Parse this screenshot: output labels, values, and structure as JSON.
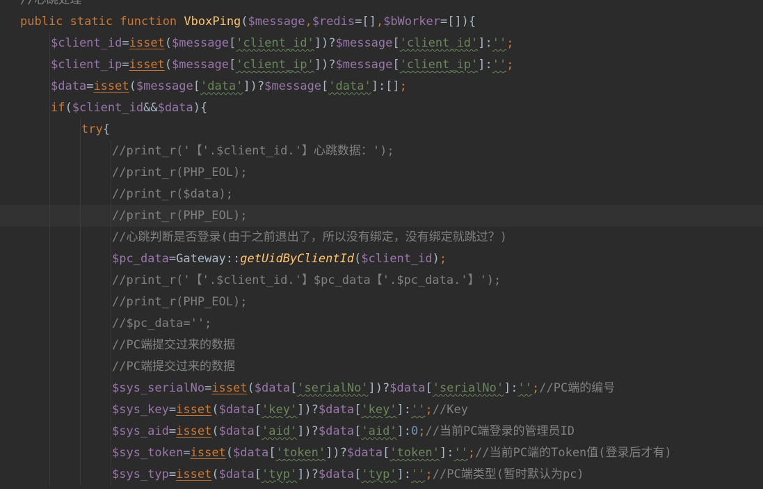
{
  "editor": {
    "lines": [
      {
        "indent": 0,
        "segments": [
          {
            "c": "cmt",
            "t": "//心跳处理"
          }
        ]
      },
      {
        "indent": 0,
        "segments": [
          {
            "c": "kw",
            "t": "public static function "
          },
          {
            "c": "fn",
            "t": "VboxPing"
          },
          {
            "c": "",
            "t": "("
          },
          {
            "c": "var",
            "t": "$message"
          },
          {
            "c": "kw",
            "t": ","
          },
          {
            "c": "var",
            "t": "$redis"
          },
          {
            "c": "",
            "t": "=[]"
          },
          {
            "c": "kw",
            "t": ","
          },
          {
            "c": "var",
            "t": "$bWorker"
          },
          {
            "c": "",
            "t": "=[]){"
          }
        ]
      },
      {
        "indent": 1,
        "segments": [
          {
            "c": "var",
            "t": "$client_id"
          },
          {
            "c": "",
            "t": "="
          },
          {
            "c": "kw uline",
            "t": "isset"
          },
          {
            "c": "",
            "t": "("
          },
          {
            "c": "var",
            "t": "$message"
          },
          {
            "c": "",
            "t": "["
          },
          {
            "c": "str wavy",
            "t": "'client_id'"
          },
          {
            "c": "",
            "t": "])?"
          },
          {
            "c": "var",
            "t": "$message"
          },
          {
            "c": "",
            "t": "["
          },
          {
            "c": "str wavy",
            "t": "'client_id'"
          },
          {
            "c": "",
            "t": "]:"
          },
          {
            "c": "str wavy",
            "t": "''"
          },
          {
            "c": "kw",
            "t": ";"
          }
        ]
      },
      {
        "indent": 1,
        "segments": [
          {
            "c": "var",
            "t": "$client_ip"
          },
          {
            "c": "",
            "t": "="
          },
          {
            "c": "kw uline",
            "t": "isset"
          },
          {
            "c": "",
            "t": "("
          },
          {
            "c": "var",
            "t": "$message"
          },
          {
            "c": "",
            "t": "["
          },
          {
            "c": "str wavy",
            "t": "'client_ip'"
          },
          {
            "c": "",
            "t": "])?"
          },
          {
            "c": "var",
            "t": "$message"
          },
          {
            "c": "",
            "t": "["
          },
          {
            "c": "str wavy",
            "t": "'client_ip'"
          },
          {
            "c": "",
            "t": "]:"
          },
          {
            "c": "str wavy",
            "t": "''"
          },
          {
            "c": "kw",
            "t": ";"
          }
        ]
      },
      {
        "indent": 1,
        "segments": [
          {
            "c": "var",
            "t": "$data"
          },
          {
            "c": "",
            "t": "="
          },
          {
            "c": "kw uline",
            "t": "isset"
          },
          {
            "c": "",
            "t": "("
          },
          {
            "c": "var",
            "t": "$message"
          },
          {
            "c": "",
            "t": "["
          },
          {
            "c": "str wavy",
            "t": "'data'"
          },
          {
            "c": "",
            "t": "])?"
          },
          {
            "c": "var",
            "t": "$message"
          },
          {
            "c": "",
            "t": "["
          },
          {
            "c": "str wavy",
            "t": "'data'"
          },
          {
            "c": "",
            "t": "]:[]"
          },
          {
            "c": "kw",
            "t": ";"
          }
        ]
      },
      {
        "indent": 1,
        "segments": [
          {
            "c": "kw",
            "t": "if"
          },
          {
            "c": "",
            "t": "("
          },
          {
            "c": "var",
            "t": "$client_id"
          },
          {
            "c": "",
            "t": "&&"
          },
          {
            "c": "var",
            "t": "$data"
          },
          {
            "c": "",
            "t": "){"
          }
        ]
      },
      {
        "indent": 2,
        "segments": [
          {
            "c": "kw",
            "t": "try"
          },
          {
            "c": "",
            "t": "{"
          }
        ]
      },
      {
        "indent": 3,
        "segments": [
          {
            "c": "cmt",
            "t": "//print_r('【'.$client_id.'】心跳数据：');"
          }
        ]
      },
      {
        "indent": 3,
        "segments": [
          {
            "c": "cmt",
            "t": "//print_r(PHP_EOL);"
          }
        ]
      },
      {
        "indent": 3,
        "segments": [
          {
            "c": "cmt",
            "t": "//print_r($data);"
          }
        ]
      },
      {
        "indent": 3,
        "current": true,
        "segments": [
          {
            "c": "cmt",
            "t": "//print_r(PHP_EOL);"
          }
        ]
      },
      {
        "indent": 3,
        "segments": [
          {
            "c": "cmt",
            "t": "//心跳判断是否登录(由于之前退出了，所以没有绑定，没有绑定就跳过？)"
          }
        ]
      },
      {
        "indent": 3,
        "segments": [
          {
            "c": "var",
            "t": "$pc_data"
          },
          {
            "c": "",
            "t": "="
          },
          {
            "c": "cls",
            "t": "Gateway"
          },
          {
            "c": "",
            "t": "::"
          },
          {
            "c": "call",
            "t": "getUidByClientId"
          },
          {
            "c": "",
            "t": "("
          },
          {
            "c": "var",
            "t": "$client_id"
          },
          {
            "c": "",
            "t": ")"
          },
          {
            "c": "kw",
            "t": ";"
          }
        ]
      },
      {
        "indent": 3,
        "segments": [
          {
            "c": "cmt",
            "t": "//print_r('【'.$client_id.'】$pc_data【'.$pc_data.'】');"
          }
        ]
      },
      {
        "indent": 3,
        "segments": [
          {
            "c": "cmt",
            "t": "//print_r(PHP_EOL);"
          }
        ]
      },
      {
        "indent": 3,
        "segments": [
          {
            "c": "cmt",
            "t": "//$pc_data='';"
          }
        ]
      },
      {
        "indent": 3,
        "segments": [
          {
            "c": "cmt",
            "t": "//PC端提交过来的数据"
          }
        ]
      },
      {
        "indent": 3,
        "segments": [
          {
            "c": "cmt",
            "t": "//PC端提交过来的数据"
          }
        ]
      },
      {
        "indent": 3,
        "segments": [
          {
            "c": "var",
            "t": "$sys_serialNo"
          },
          {
            "c": "",
            "t": "="
          },
          {
            "c": "kw uline",
            "t": "isset"
          },
          {
            "c": "",
            "t": "("
          },
          {
            "c": "var",
            "t": "$data"
          },
          {
            "c": "",
            "t": "["
          },
          {
            "c": "str wavy",
            "t": "'serialNo'"
          },
          {
            "c": "",
            "t": "])?"
          },
          {
            "c": "var",
            "t": "$data"
          },
          {
            "c": "",
            "t": "["
          },
          {
            "c": "str wavy",
            "t": "'serialNo'"
          },
          {
            "c": "",
            "t": "]:"
          },
          {
            "c": "str wavy",
            "t": "''"
          },
          {
            "c": "kw",
            "t": ";"
          },
          {
            "c": "cmt",
            "t": "//PC端的编号"
          }
        ]
      },
      {
        "indent": 3,
        "segments": [
          {
            "c": "var",
            "t": "$sys_key"
          },
          {
            "c": "",
            "t": "="
          },
          {
            "c": "kw uline",
            "t": "isset"
          },
          {
            "c": "",
            "t": "("
          },
          {
            "c": "var",
            "t": "$data"
          },
          {
            "c": "",
            "t": "["
          },
          {
            "c": "str wavy",
            "t": "'key'"
          },
          {
            "c": "",
            "t": "])?"
          },
          {
            "c": "var",
            "t": "$data"
          },
          {
            "c": "",
            "t": "["
          },
          {
            "c": "str wavy",
            "t": "'key'"
          },
          {
            "c": "",
            "t": "]:"
          },
          {
            "c": "str wavy",
            "t": "''"
          },
          {
            "c": "kw",
            "t": ";"
          },
          {
            "c": "cmt",
            "t": "//Key"
          }
        ]
      },
      {
        "indent": 3,
        "segments": [
          {
            "c": "var",
            "t": "$sys_aid"
          },
          {
            "c": "",
            "t": "="
          },
          {
            "c": "kw uline",
            "t": "isset"
          },
          {
            "c": "",
            "t": "("
          },
          {
            "c": "var",
            "t": "$data"
          },
          {
            "c": "",
            "t": "["
          },
          {
            "c": "str wavy",
            "t": "'aid'"
          },
          {
            "c": "",
            "t": "])?"
          },
          {
            "c": "var",
            "t": "$data"
          },
          {
            "c": "",
            "t": "["
          },
          {
            "c": "str wavy",
            "t": "'aid'"
          },
          {
            "c": "",
            "t": "]:"
          },
          {
            "c": "num",
            "t": "0"
          },
          {
            "c": "kw",
            "t": ";"
          },
          {
            "c": "cmt",
            "t": "//当前PC端登录的管理员ID"
          }
        ]
      },
      {
        "indent": 3,
        "segments": [
          {
            "c": "var",
            "t": "$sys_token"
          },
          {
            "c": "",
            "t": "="
          },
          {
            "c": "kw uline",
            "t": "isset"
          },
          {
            "c": "",
            "t": "("
          },
          {
            "c": "var",
            "t": "$data"
          },
          {
            "c": "",
            "t": "["
          },
          {
            "c": "str wavy",
            "t": "'token'"
          },
          {
            "c": "",
            "t": "])?"
          },
          {
            "c": "var",
            "t": "$data"
          },
          {
            "c": "",
            "t": "["
          },
          {
            "c": "str wavy",
            "t": "'token'"
          },
          {
            "c": "",
            "t": "]:"
          },
          {
            "c": "str wavy",
            "t": "''"
          },
          {
            "c": "kw",
            "t": ";"
          },
          {
            "c": "cmt",
            "t": "//当前PC端的Token值(登录后才有)"
          }
        ]
      },
      {
        "indent": 3,
        "segments": [
          {
            "c": "var",
            "t": "$sys_typ"
          },
          {
            "c": "",
            "t": "="
          },
          {
            "c": "kw uline",
            "t": "isset"
          },
          {
            "c": "",
            "t": "("
          },
          {
            "c": "var",
            "t": "$data"
          },
          {
            "c": "",
            "t": "["
          },
          {
            "c": "str wavy",
            "t": "'typ'"
          },
          {
            "c": "",
            "t": "])?"
          },
          {
            "c": "var",
            "t": "$data"
          },
          {
            "c": "",
            "t": "["
          },
          {
            "c": "str wavy",
            "t": "'typ'"
          },
          {
            "c": "",
            "t": "]:"
          },
          {
            "c": "str wavy",
            "t": "''"
          },
          {
            "c": "kw",
            "t": ";"
          },
          {
            "c": "cmt",
            "t": "//PC端类型(暂时默认为pc)"
          }
        ]
      }
    ]
  }
}
